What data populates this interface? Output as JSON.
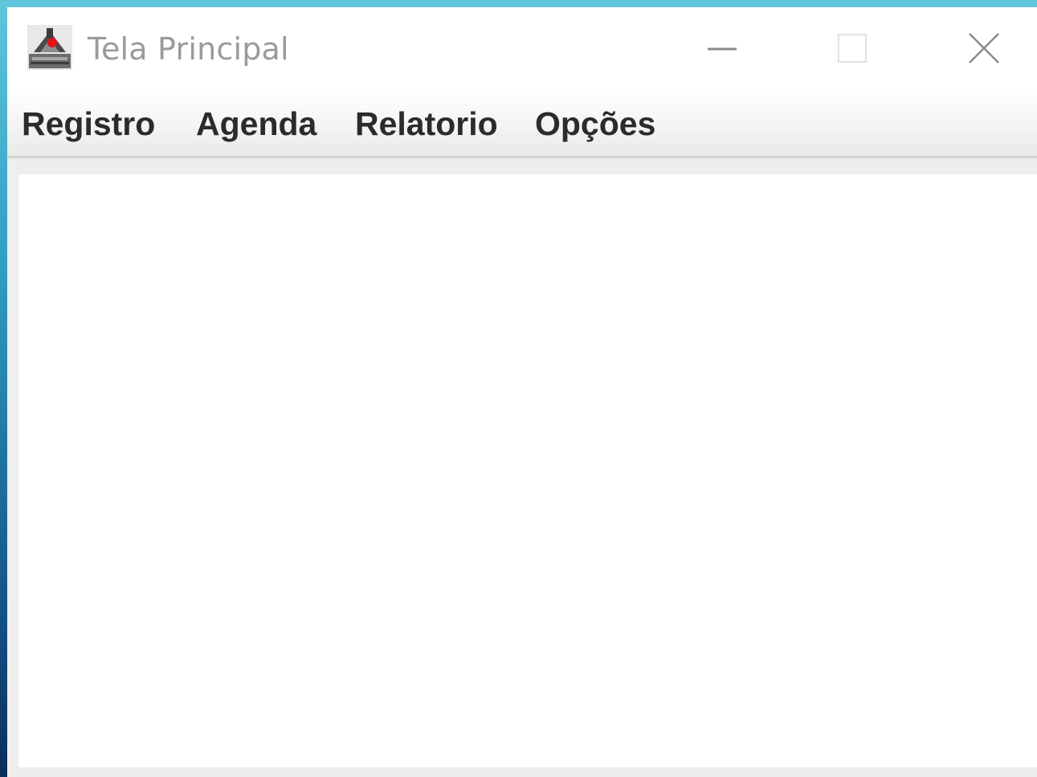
{
  "window": {
    "title": "Tela Principal",
    "icon": "java-app-icon",
    "controls": {
      "minimize": "minimize-icon",
      "maximize": "maximize-icon",
      "close": "close-icon"
    }
  },
  "menubar": {
    "items": [
      {
        "label": "Registro"
      },
      {
        "label": "Agenda"
      },
      {
        "label": "Relatorio"
      },
      {
        "label": "Opções"
      }
    ]
  },
  "colors": {
    "title_text": "#9a9a9a",
    "menu_text": "#2b2b2b",
    "desktop_top": "#5fc6da",
    "desktop_bottom": "#0b2e5a",
    "content_background": "#ffffff"
  }
}
